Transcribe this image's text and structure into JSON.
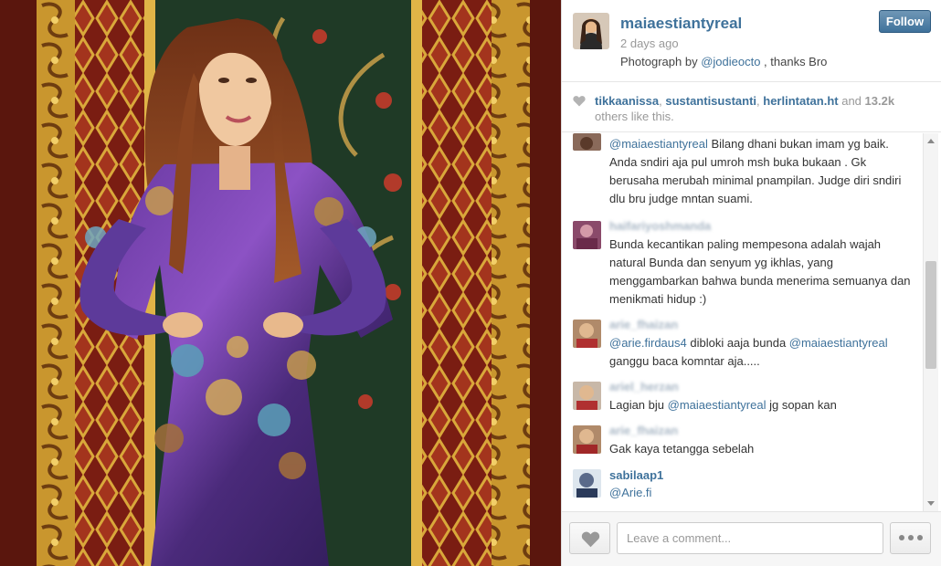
{
  "post": {
    "username": "maiaestiantyreal",
    "follow_label": "Follow",
    "time_ago": "2 days ago",
    "caption_prefix": "Photograph by ",
    "caption_mention": "@jodieocto",
    "caption_suffix": " , thanks Bro"
  },
  "likes": {
    "likers": [
      "tikkaanissa",
      "sustantisustanti",
      "herlintatan.ht"
    ],
    "separator": ", ",
    "and_text": " and ",
    "count": "13.2k",
    "others_text": "others like this."
  },
  "comments": [
    {
      "username": "",
      "mention": "@maiaestiantyreal",
      "text": " Bilang dhani bukan imam yg baik. Anda sndiri aja pul umroh msh buka bukaan . Gk berusaha merubah minimal pnampilan. Judge diri sndiri dlu bru judge mntan suami."
    },
    {
      "username": "haifariyoshmanda",
      "text": "Bunda kecantikan paling mempesona adalah wajah natural Bunda dan senyum yg ikhlas, yang menggambarkan bahwa bunda menerima semuanya dan menikmati hidup :)"
    },
    {
      "username": "arie_fhaizan",
      "mention1": "@arie.firdaus4",
      "mid_text": " dibloki aaja bunda ",
      "mention2": "@maiaestiantyreal",
      "end_text": " ganggu baca komntar aja....."
    },
    {
      "username": "ariel_herzan",
      "prefix": "Lagian bju ",
      "mention": "@maiaestiantyreal",
      "suffix": " jg sopan kan"
    },
    {
      "username": "arie_fhaizan",
      "text": "Gak kaya tetangga sebelah"
    },
    {
      "username": "sabilaap1",
      "mention": "@Arie.fi"
    }
  ],
  "footer": {
    "comment_placeholder": "Leave a comment..."
  },
  "colors": {
    "link": "#3f729b",
    "follow_button": "#3f729b",
    "muted_text": "#999999"
  }
}
